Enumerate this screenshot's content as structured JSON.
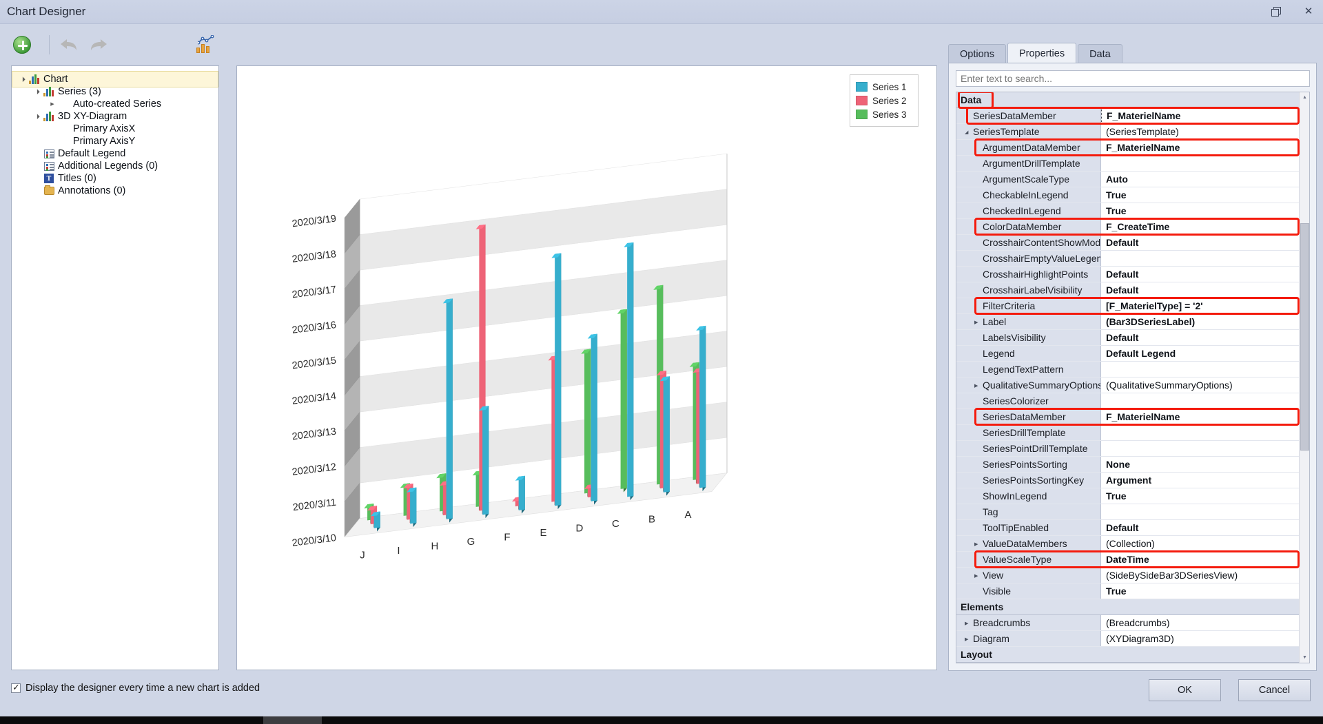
{
  "window": {
    "title": "Chart Designer",
    "restore_icon": "restore-icon",
    "close_icon": "close-icon",
    "close_glyph": "✕"
  },
  "toolbar": {
    "add_icon": "add-circle-icon",
    "undo_icon": "undo-arrow-icon",
    "undo_glyph": "↰",
    "redo_icon": "redo-arrow-icon",
    "redo_glyph": "↱",
    "wizard_icon": "chart-wizard-icon"
  },
  "tree": {
    "items": [
      {
        "label": "Chart",
        "indent": 0,
        "expander": "open",
        "icon": "bar-chart-icon",
        "selected": true
      },
      {
        "label": "Series (3)",
        "indent": 1,
        "expander": "open",
        "icon": "bar-chart-icon",
        "selected": false
      },
      {
        "label": "Auto-created Series",
        "indent": 2,
        "expander": "closed",
        "icon": "none",
        "selected": false
      },
      {
        "label": "3D XY-Diagram",
        "indent": 1,
        "expander": "open",
        "icon": "bar-chart-icon",
        "selected": false
      },
      {
        "label": "Primary AxisX",
        "indent": 2,
        "expander": "none",
        "icon": "none",
        "selected": false
      },
      {
        "label": "Primary AxisY",
        "indent": 2,
        "expander": "none",
        "icon": "none",
        "selected": false
      },
      {
        "label": "Default Legend",
        "indent": 1,
        "expander": "none",
        "icon": "legend-icon",
        "selected": false
      },
      {
        "label": "Additional Legends (0)",
        "indent": 1,
        "expander": "none",
        "icon": "legend-icon",
        "selected": false
      },
      {
        "label": "Titles (0)",
        "indent": 1,
        "expander": "none",
        "icon": "title-icon",
        "selected": false
      },
      {
        "label": "Annotations (0)",
        "indent": 1,
        "expander": "none",
        "icon": "folder-icon",
        "selected": false
      }
    ]
  },
  "legend": {
    "entries": [
      {
        "label": "Series 1",
        "color": "#36aecd"
      },
      {
        "label": "Series 2",
        "color": "#ee6377"
      },
      {
        "label": "Series 3",
        "color": "#57bd5c"
      }
    ]
  },
  "chart_data": {
    "type": "bar",
    "title": "",
    "xlabel": "",
    "ylabel": "",
    "categories": [
      "J",
      "I",
      "H",
      "G",
      "F",
      "E",
      "D",
      "C",
      "B",
      "A"
    ],
    "ytick_labels": [
      "2020/3/10",
      "2020/3/11",
      "2020/3/12",
      "2020/3/13",
      "2020/3/14",
      "2020/3/15",
      "2020/3/16",
      "2020/3/17",
      "2020/3/18",
      "2020/3/19"
    ],
    "ylim": [
      "2020/3/10",
      "2020/3/19"
    ],
    "grid": true,
    "legend_position": "top-right",
    "projection": "3d-side-by-side-bar",
    "series": [
      {
        "name": "Series 3",
        "color": "#57bd5c",
        "values": [
          0.45,
          0.9,
          1.05,
          1.0,
          0.0,
          0.0,
          4.05,
          5.05,
          5.6,
          3.3
        ]
      },
      {
        "name": "Series 2",
        "color": "#ee6377",
        "values": [
          0.5,
          1.0,
          0.95,
          8.05,
          0.25,
          4.1,
          0.35,
          0.0,
          3.3,
          3.25
        ]
      },
      {
        "name": "Series 1",
        "color": "#36aecd",
        "values": [
          0.45,
          1.0,
          6.2,
          3.05,
          0.95,
          7.1,
          4.7,
          7.15,
          3.25,
          4.55
        ]
      }
    ]
  },
  "right_panel": {
    "tabs": [
      {
        "label": "Options",
        "active": false
      },
      {
        "label": "Properties",
        "active": true
      },
      {
        "label": "Data",
        "active": false
      }
    ],
    "search": {
      "value": "",
      "placeholder": "Enter text to search..."
    },
    "scrollbar": {
      "up_glyph": "▲",
      "down_glyph": "▼"
    },
    "groups": [
      {
        "name": "Data",
        "collapse_glyph": "▲",
        "highlight": true,
        "rows": [
          {
            "name": "SeriesDataMember",
            "value": "F_MaterielName",
            "bold": true,
            "level": 1,
            "expander": "",
            "highlight": true,
            "editing": true,
            "dropdown_glyph": "▼"
          },
          {
            "name": "SeriesTemplate",
            "value": "(SeriesTemplate)",
            "bold": false,
            "level": 1,
            "expander": "open",
            "highlight": false,
            "editing": false
          },
          {
            "name": "ArgumentDataMember",
            "value": "F_MaterielName",
            "bold": true,
            "level": 2,
            "expander": "",
            "highlight": true,
            "editing": false
          },
          {
            "name": "ArgumentDrillTemplate",
            "value": "",
            "bold": false,
            "level": 2,
            "expander": "",
            "highlight": false,
            "editing": false
          },
          {
            "name": "ArgumentScaleType",
            "value": "Auto",
            "bold": true,
            "level": 2,
            "expander": "",
            "highlight": false,
            "editing": false
          },
          {
            "name": "CheckableInLegend",
            "value": "True",
            "bold": true,
            "level": 2,
            "expander": "",
            "highlight": false,
            "editing": false
          },
          {
            "name": "CheckedInLegend",
            "value": "True",
            "bold": true,
            "level": 2,
            "expander": "",
            "highlight": false,
            "editing": false
          },
          {
            "name": "ColorDataMember",
            "value": "F_CreateTime",
            "bold": true,
            "level": 2,
            "expander": "",
            "highlight": true,
            "editing": false
          },
          {
            "name": "CrosshairContentShowMode",
            "value": "Default",
            "bold": true,
            "level": 2,
            "expander": "",
            "highlight": false,
            "editing": false
          },
          {
            "name": "CrosshairEmptyValueLegend...",
            "value": "",
            "bold": false,
            "level": 2,
            "expander": "",
            "highlight": false,
            "editing": false
          },
          {
            "name": "CrosshairHighlightPoints",
            "value": "Default",
            "bold": true,
            "level": 2,
            "expander": "",
            "highlight": false,
            "editing": false
          },
          {
            "name": "CrosshairLabelVisibility",
            "value": "Default",
            "bold": true,
            "level": 2,
            "expander": "",
            "highlight": false,
            "editing": false
          },
          {
            "name": "FilterCriteria",
            "value": "[F_MaterielType] = '2'",
            "bold": true,
            "level": 2,
            "expander": "",
            "highlight": true,
            "editing": false
          },
          {
            "name": "Label",
            "value": "(Bar3DSeriesLabel)",
            "bold": true,
            "level": 2,
            "expander": "closed",
            "highlight": false,
            "editing": false
          },
          {
            "name": "LabelsVisibility",
            "value": "Default",
            "bold": true,
            "level": 2,
            "expander": "",
            "highlight": false,
            "editing": false
          },
          {
            "name": "Legend",
            "value": "Default Legend",
            "bold": true,
            "level": 2,
            "expander": "",
            "highlight": false,
            "editing": false
          },
          {
            "name": "LegendTextPattern",
            "value": "",
            "bold": false,
            "level": 2,
            "expander": "",
            "highlight": false,
            "editing": false
          },
          {
            "name": "QualitativeSummaryOptions",
            "value": "(QualitativeSummaryOptions)",
            "bold": false,
            "level": 2,
            "expander": "closed",
            "highlight": false,
            "editing": false
          },
          {
            "name": "SeriesColorizer",
            "value": "",
            "bold": false,
            "level": 2,
            "expander": "",
            "highlight": false,
            "editing": false
          },
          {
            "name": "SeriesDataMember",
            "value": "F_MaterielName",
            "bold": true,
            "level": 2,
            "expander": "",
            "highlight": true,
            "editing": false
          },
          {
            "name": "SeriesDrillTemplate",
            "value": "",
            "bold": false,
            "level": 2,
            "expander": "",
            "highlight": false,
            "editing": false
          },
          {
            "name": "SeriesPointDrillTemplate",
            "value": "",
            "bold": false,
            "level": 2,
            "expander": "",
            "highlight": false,
            "editing": false
          },
          {
            "name": "SeriesPointsSorting",
            "value": "None",
            "bold": true,
            "level": 2,
            "expander": "",
            "highlight": false,
            "editing": false
          },
          {
            "name": "SeriesPointsSortingKey",
            "value": "Argument",
            "bold": true,
            "level": 2,
            "expander": "",
            "highlight": false,
            "editing": false
          },
          {
            "name": "ShowInLegend",
            "value": "True",
            "bold": true,
            "level": 2,
            "expander": "",
            "highlight": false,
            "editing": false
          },
          {
            "name": "Tag",
            "value": "",
            "bold": false,
            "level": 2,
            "expander": "",
            "highlight": false,
            "editing": false
          },
          {
            "name": "ToolTipEnabled",
            "value": "Default",
            "bold": true,
            "level": 2,
            "expander": "",
            "highlight": false,
            "editing": false
          },
          {
            "name": "ValueDataMembers",
            "value": "(Collection)",
            "bold": false,
            "level": 2,
            "expander": "closed",
            "highlight": false,
            "editing": false
          },
          {
            "name": "ValueScaleType",
            "value": "DateTime",
            "bold": true,
            "level": 2,
            "expander": "",
            "highlight": true,
            "editing": false
          },
          {
            "name": "View",
            "value": "(SideBySideBar3DSeriesView)",
            "bold": false,
            "level": 2,
            "expander": "closed",
            "highlight": false,
            "editing": false
          },
          {
            "name": "Visible",
            "value": "True",
            "bold": true,
            "level": 2,
            "expander": "",
            "highlight": false,
            "editing": false
          }
        ]
      },
      {
        "name": "Elements",
        "collapse_glyph": "▲",
        "highlight": false,
        "rows": [
          {
            "name": "Breadcrumbs",
            "value": "(Breadcrumbs)",
            "bold": false,
            "level": 1,
            "expander": "closed",
            "highlight": false,
            "editing": false
          },
          {
            "name": "Diagram",
            "value": "(XYDiagram3D)",
            "bold": false,
            "level": 1,
            "expander": "closed",
            "highlight": false,
            "editing": false
          }
        ]
      },
      {
        "name": "Layout",
        "collapse_glyph": "",
        "highlight": false,
        "rows": []
      }
    ]
  },
  "footer": {
    "checkbox_label": "Display the designer every time a new chart is added",
    "checkbox_checked": true,
    "ok_label": "OK",
    "cancel_label": "Cancel"
  }
}
